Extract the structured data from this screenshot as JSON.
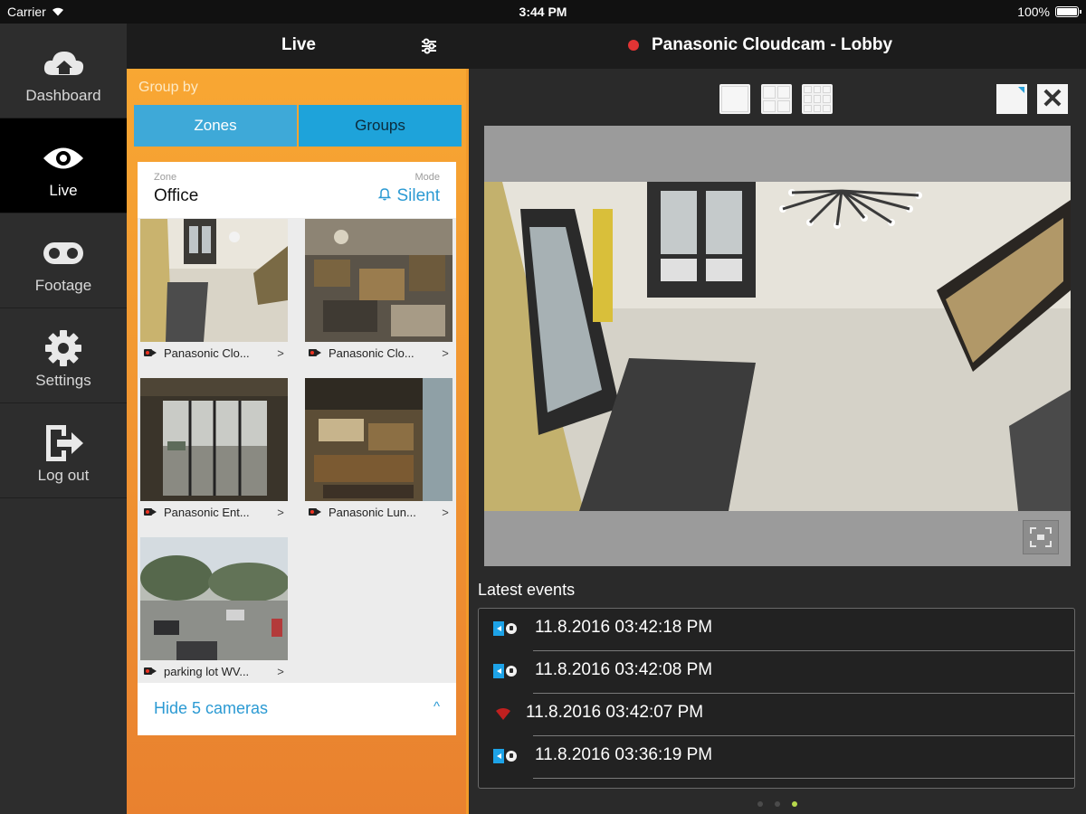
{
  "status_bar": {
    "carrier": "Carrier",
    "time": "3:44 PM",
    "battery": "100%"
  },
  "sidebar": {
    "items": [
      {
        "label": "Dashboard",
        "icon": "cloud-home-icon",
        "active": false
      },
      {
        "label": "Live",
        "icon": "eye-icon",
        "active": true
      },
      {
        "label": "Footage",
        "icon": "tape-icon",
        "active": false
      },
      {
        "label": "Settings",
        "icon": "gear-icon",
        "active": false
      },
      {
        "label": "Log out",
        "icon": "logout-icon",
        "active": false
      }
    ]
  },
  "header": {
    "section_title": "Live",
    "camera_title": "Panasonic Cloudcam - Lobby",
    "recording_color": "#e23434"
  },
  "group_panel": {
    "group_by_label": "Group by",
    "segments": [
      "Zones",
      "Groups"
    ],
    "zone_caption": "Zone",
    "zone_name": "Office",
    "mode_caption": "Mode",
    "mode_value": "Silent",
    "cameras": [
      {
        "name": "Panasonic Clo...",
        "chevron": ">"
      },
      {
        "name": "Panasonic Clo...",
        "chevron": ">"
      },
      {
        "name": "Panasonic Ent...",
        "chevron": ">"
      },
      {
        "name": "Panasonic Lun...",
        "chevron": ">"
      },
      {
        "name": "parking lot WV...",
        "chevron": ">"
      }
    ],
    "hide_label": "Hide 5 cameras",
    "hide_chevron": "^"
  },
  "viewer": {
    "close_symbol": "✕",
    "events_title": "Latest events",
    "events": [
      {
        "type": "motion",
        "time": "11.8.2016 03:42:18 PM"
      },
      {
        "type": "motion",
        "time": "11.8.2016 03:42:08 PM"
      },
      {
        "type": "connection",
        "time": "11.8.2016 03:42:07 PM"
      },
      {
        "type": "motion",
        "time": "11.8.2016 03:36:19 PM"
      }
    ],
    "pager_active_index": 2,
    "pager_count": 3
  },
  "colors": {
    "accent_orange": "#f8a733",
    "accent_blue": "#2b9ad3",
    "sidebar_active": "#000000"
  }
}
